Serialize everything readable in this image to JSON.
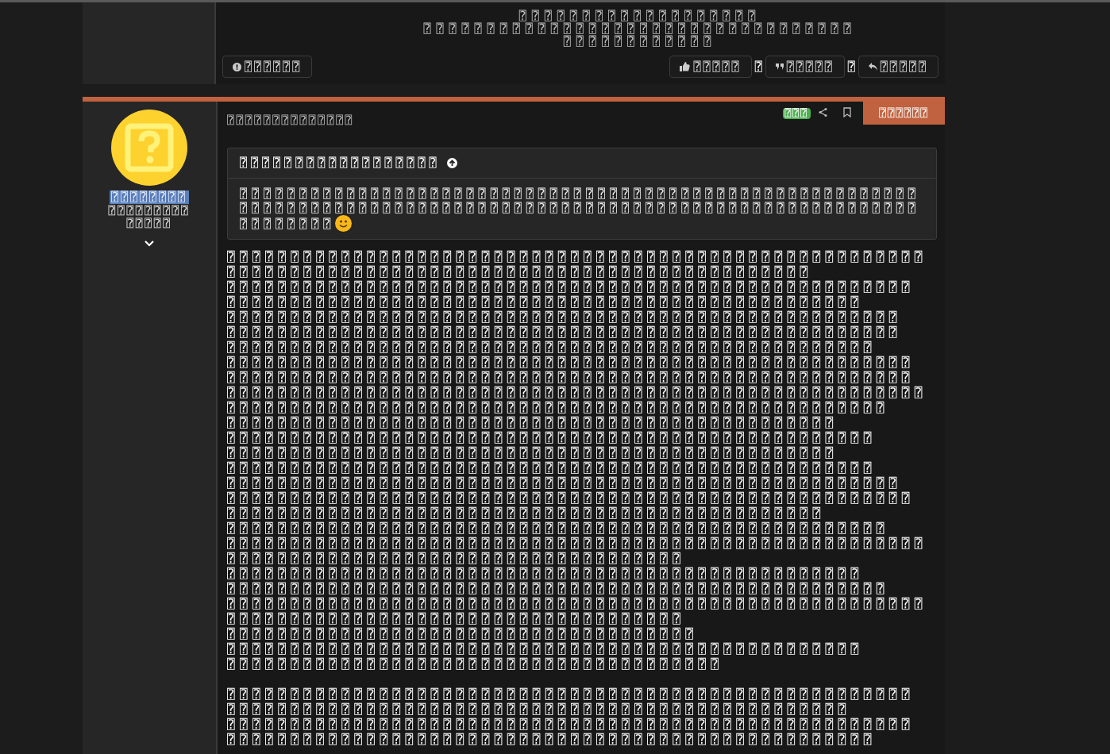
{
  "previous_post": {
    "signature_lines": [
      "⍰⍰⍰⍰⍰⍰⍰⍰⍰⍰⍰⍰⍰⍰⍰⍰⍰⍰⍰",
      "⍰⍰⍰⍰⍰⍰⍰⍰⍰⍰⍰⍰⍰⍰⍰⍰⍰⍰⍰⍰⍰⍰⍰⍰⍰⍰⍰⍰⍰⍰⍰⍰⍰⍰",
      "⍰⍰⍰⍰⍰⍰⍰⍰⍰⍰⍰⍰"
    ],
    "report_button": "⍰⍰⍰⍰⍰⍰",
    "like_button": "⍰⍰⍰⍰⍰",
    "like_count": "⍰",
    "quote_button": "⍰⍰⍰⍰⍰",
    "quote_count": "⍰",
    "reply_button": "⍰⍰⍰⍰⍰"
  },
  "post": {
    "author": {
      "name": "⍰⍰⍰⍰⍰⍰⍰⍰",
      "title": "⍰⍰⍰⍰⍰⍰⍰⍰⍰",
      "subtitle": "⍰⍰⍰⍰⍰"
    },
    "date": "⍰⍰⍰⍰⍰⍰⍰⍰⍰⍰⍰⍰⍰⍰",
    "badge": "⍰⍰⍰",
    "action_button": "⍰⍰⍰⍰⍰⍰",
    "quote": {
      "title": "⍰⍰⍰⍰⍰⍰⍰⍰⍰⍰⍰⍰⍰⍰⍰⍰⍰⍰",
      "lines": [
        "⍰⍰⍰⍰⍰⍰⍰⍰⍰⍰⍰⍰⍰⍰⍰⍰⍰⍰⍰⍰⍰⍰⍰⍰⍰⍰⍰⍰⍰⍰⍰⍰⍰⍰⍰⍰⍰⍰⍰⍰⍰⍰⍰⍰⍰⍰⍰⍰⍰⍰⍰⍰⍰⍰⍰⍰⍰",
        "⍰⍰⍰⍰⍰⍰⍰⍰⍰⍰⍰⍰⍰⍰⍰⍰⍰⍰⍰⍰⍰⍰⍰⍰⍰⍰⍰⍰⍰⍰⍰⍰⍰⍰⍰⍰⍰⍰⍰⍰⍰⍰⍰⍰⍰⍰⍰⍰⍰⍰⍰⍰⍰⍰⍰⍰⍰",
        "⍰⍰⍰⍰⍰⍰⍰⍰"
      ]
    },
    "paragraphs": [
      [
        "⍰⍰⍰⍰⍰⍰⍰⍰⍰⍰⍰⍰⍰⍰⍰⍰⍰⍰⍰⍰⍰⍰⍰⍰⍰⍰⍰⍰⍰⍰⍰⍰⍰⍰⍰⍰⍰⍰⍰⍰⍰⍰⍰⍰⍰⍰⍰⍰⍰⍰⍰⍰⍰⍰⍰",
        "⍰⍰⍰⍰⍰⍰⍰⍰⍰⍰⍰⍰⍰⍰⍰⍰⍰⍰⍰⍰⍰⍰⍰⍰⍰⍰⍰⍰⍰⍰⍰⍰⍰⍰⍰⍰⍰⍰⍰⍰⍰⍰⍰⍰⍰⍰",
        "⍰⍰⍰⍰⍰⍰⍰⍰⍰⍰⍰⍰⍰⍰⍰⍰⍰⍰⍰⍰⍰⍰⍰⍰⍰⍰⍰⍰⍰⍰⍰⍰⍰⍰⍰⍰⍰⍰⍰⍰⍰⍰⍰⍰⍰⍰⍰⍰⍰⍰⍰⍰⍰⍰",
        "⍰⍰⍰⍰⍰⍰⍰⍰⍰⍰⍰⍰⍰⍰⍰⍰⍰⍰⍰⍰⍰⍰⍰⍰⍰⍰⍰⍰⍰⍰⍰⍰⍰⍰⍰⍰⍰⍰⍰⍰⍰⍰⍰⍰⍰⍰⍰⍰⍰⍰",
        "⍰⍰⍰⍰⍰⍰⍰⍰⍰⍰⍰⍰⍰⍰⍰⍰⍰⍰⍰⍰⍰⍰⍰⍰⍰⍰⍰⍰⍰⍰⍰⍰⍰⍰⍰⍰⍰⍰⍰⍰⍰⍰⍰⍰⍰⍰⍰⍰⍰⍰⍰⍰⍰",
        "⍰⍰⍰⍰⍰⍰⍰⍰⍰⍰⍰⍰⍰⍰⍰⍰⍰⍰⍰⍰⍰⍰⍰⍰⍰⍰⍰⍰⍰⍰⍰⍰⍰⍰⍰⍰⍰⍰⍰⍰⍰⍰⍰⍰⍰⍰⍰⍰⍰⍰⍰⍰⍰",
        "⍰⍰⍰⍰⍰⍰⍰⍰⍰⍰⍰⍰⍰⍰⍰⍰⍰⍰⍰⍰⍰⍰⍰⍰⍰⍰⍰⍰⍰⍰⍰⍰⍰⍰⍰⍰⍰⍰⍰⍰⍰⍰⍰⍰⍰⍰⍰⍰⍰⍰⍰",
        "⍰⍰⍰⍰⍰⍰⍰⍰⍰⍰⍰⍰⍰⍰⍰⍰⍰⍰⍰⍰⍰⍰⍰⍰⍰⍰⍰⍰⍰⍰⍰⍰⍰⍰⍰⍰⍰⍰⍰⍰⍰⍰⍰⍰⍰⍰⍰⍰⍰⍰⍰⍰⍰⍰",
        "⍰⍰⍰⍰⍰⍰⍰⍰⍰⍰⍰⍰⍰⍰⍰⍰⍰⍰⍰⍰⍰⍰⍰⍰⍰⍰⍰⍰⍰⍰⍰⍰⍰⍰⍰⍰⍰⍰⍰⍰⍰⍰⍰⍰⍰⍰⍰⍰⍰⍰⍰⍰⍰⍰",
        "⍰⍰⍰⍰⍰⍰⍰⍰⍰⍰⍰⍰⍰⍰⍰⍰⍰⍰⍰⍰⍰⍰⍰⍰⍰⍰⍰⍰⍰⍰⍰⍰⍰⍰⍰⍰⍰⍰⍰⍰⍰⍰⍰⍰⍰⍰⍰⍰⍰⍰⍰⍰⍰⍰⍰",
        "⍰⍰⍰⍰⍰⍰⍰⍰⍰⍰⍰⍰⍰⍰⍰⍰⍰⍰⍰⍰⍰⍰⍰⍰⍰⍰⍰⍰⍰⍰⍰⍰⍰⍰⍰⍰⍰⍰⍰⍰⍰⍰⍰⍰⍰⍰⍰⍰⍰⍰⍰⍰",
        "⍰⍰⍰⍰⍰⍰⍰⍰⍰⍰⍰⍰⍰⍰⍰⍰⍰⍰⍰⍰⍰⍰⍰⍰⍰⍰⍰⍰⍰⍰⍰⍰⍰⍰⍰⍰⍰⍰⍰⍰⍰⍰⍰⍰⍰⍰⍰⍰",
        "⍰⍰⍰⍰⍰⍰⍰⍰⍰⍰⍰⍰⍰⍰⍰⍰⍰⍰⍰⍰⍰⍰⍰⍰⍰⍰⍰⍰⍰⍰⍰⍰⍰⍰⍰⍰⍰⍰⍰⍰⍰⍰⍰⍰⍰⍰⍰⍰⍰⍰⍰",
        "⍰⍰⍰⍰⍰⍰⍰⍰⍰⍰⍰⍰⍰⍰⍰⍰⍰⍰⍰⍰⍰⍰⍰⍰⍰⍰⍰⍰⍰⍰⍰⍰⍰⍰⍰⍰⍰⍰⍰⍰⍰⍰⍰⍰⍰⍰⍰⍰",
        "⍰⍰⍰⍰⍰⍰⍰⍰⍰⍰⍰⍰⍰⍰⍰⍰⍰⍰⍰⍰⍰⍰⍰⍰⍰⍰⍰⍰⍰⍰⍰⍰⍰⍰⍰⍰⍰⍰⍰⍰⍰⍰⍰⍰⍰⍰⍰⍰⍰⍰⍰",
        "⍰⍰⍰⍰⍰⍰⍰⍰⍰⍰⍰⍰⍰⍰⍰⍰⍰⍰⍰⍰⍰⍰⍰⍰⍰⍰⍰⍰⍰⍰⍰⍰⍰⍰⍰⍰⍰⍰⍰⍰⍰⍰⍰⍰⍰⍰⍰⍰⍰⍰⍰⍰⍰",
        "⍰⍰⍰⍰⍰⍰⍰⍰⍰⍰⍰⍰⍰⍰⍰⍰⍰⍰⍰⍰⍰⍰⍰⍰⍰⍰⍰⍰⍰⍰⍰⍰⍰⍰⍰⍰⍰⍰⍰⍰⍰⍰⍰⍰⍰⍰⍰⍰⍰⍰⍰⍰⍰⍰",
        "⍰⍰⍰⍰⍰⍰⍰⍰⍰⍰⍰⍰⍰⍰⍰⍰⍰⍰⍰⍰⍰⍰⍰⍰⍰⍰⍰⍰⍰⍰⍰⍰⍰⍰⍰⍰⍰⍰⍰⍰⍰⍰⍰⍰⍰⍰⍰",
        "⍰⍰⍰⍰⍰⍰⍰⍰⍰⍰⍰⍰⍰⍰⍰⍰⍰⍰⍰⍰⍰⍰⍰⍰⍰⍰⍰⍰⍰⍰⍰⍰⍰⍰⍰⍰⍰⍰⍰⍰⍰⍰⍰⍰⍰⍰⍰⍰⍰⍰⍰⍰",
        "⍰⍰⍰⍰⍰⍰⍰⍰⍰⍰⍰⍰⍰⍰⍰⍰⍰⍰⍰⍰⍰⍰⍰⍰⍰⍰⍰⍰⍰⍰⍰⍰⍰⍰⍰⍰⍰⍰⍰⍰⍰⍰⍰⍰⍰⍰⍰⍰⍰⍰⍰⍰⍰⍰⍰",
        "⍰⍰⍰⍰⍰⍰⍰⍰⍰⍰⍰⍰⍰⍰⍰⍰⍰⍰⍰⍰⍰⍰⍰⍰⍰⍰⍰⍰⍰⍰⍰⍰⍰⍰⍰⍰",
        "⍰⍰⍰⍰⍰⍰⍰⍰⍰⍰⍰⍰⍰⍰⍰⍰⍰⍰⍰⍰⍰⍰⍰⍰⍰⍰⍰⍰⍰⍰⍰⍰⍰⍰⍰⍰⍰⍰⍰⍰⍰⍰⍰⍰⍰⍰⍰⍰⍰⍰",
        "⍰⍰⍰⍰⍰⍰⍰⍰⍰⍰⍰⍰⍰⍰⍰⍰⍰⍰⍰⍰⍰⍰⍰⍰⍰⍰⍰⍰⍰⍰⍰⍰⍰⍰⍰⍰⍰⍰⍰⍰⍰⍰⍰⍰⍰⍰⍰⍰⍰⍰⍰⍰",
        "⍰⍰⍰⍰⍰⍰⍰⍰⍰⍰⍰⍰⍰⍰⍰⍰⍰⍰⍰⍰⍰⍰⍰⍰⍰⍰⍰⍰⍰⍰⍰⍰⍰⍰⍰⍰⍰⍰⍰⍰⍰⍰⍰⍰⍰⍰⍰⍰⍰⍰⍰⍰⍰⍰⍰",
        "⍰⍰⍰⍰⍰⍰⍰⍰⍰⍰⍰⍰⍰⍰⍰⍰⍰⍰⍰⍰⍰⍰⍰⍰⍰⍰⍰⍰⍰⍰⍰⍰⍰⍰⍰⍰",
        "⍰⍰⍰⍰⍰⍰⍰⍰⍰⍰⍰⍰⍰⍰⍰⍰⍰⍰⍰⍰⍰⍰⍰⍰⍰⍰⍰⍰⍰⍰⍰⍰⍰⍰⍰⍰⍰",
        "⍰⍰⍰⍰⍰⍰⍰⍰⍰⍰⍰⍰⍰⍰⍰⍰⍰⍰⍰⍰⍰⍰⍰⍰⍰⍰⍰⍰⍰⍰⍰⍰⍰⍰⍰⍰⍰⍰⍰⍰⍰⍰⍰⍰⍰⍰⍰⍰⍰⍰",
        "⍰⍰⍰⍰⍰⍰⍰⍰⍰⍰⍰⍰⍰⍰⍰⍰⍰⍰⍰⍰⍰⍰⍰⍰⍰⍰⍰⍰⍰⍰⍰⍰⍰⍰⍰⍰⍰⍰⍰"
      ],
      [
        "⍰⍰⍰⍰⍰⍰⍰⍰⍰⍰⍰⍰⍰⍰⍰⍰⍰⍰⍰⍰⍰⍰⍰⍰⍰⍰⍰⍰⍰⍰⍰⍰⍰⍰⍰⍰⍰⍰⍰⍰⍰⍰⍰⍰⍰⍰⍰⍰⍰⍰⍰⍰⍰⍰",
        "⍰⍰⍰⍰⍰⍰⍰⍰⍰⍰⍰⍰⍰⍰⍰⍰⍰⍰⍰⍰⍰⍰⍰⍰⍰⍰⍰⍰⍰⍰⍰⍰⍰⍰⍰⍰⍰⍰⍰⍰⍰⍰⍰⍰⍰⍰⍰⍰⍰",
        "⍰⍰⍰⍰⍰⍰⍰⍰⍰⍰⍰⍰⍰⍰⍰⍰⍰⍰⍰⍰⍰⍰⍰⍰⍰⍰⍰⍰⍰⍰⍰⍰⍰⍰⍰⍰⍰⍰⍰⍰⍰⍰⍰⍰⍰⍰⍰⍰⍰⍰⍰⍰⍰⍰",
        "⍰⍰⍰⍰⍰⍰⍰⍰⍰⍰⍰⍰⍰⍰⍰⍰⍰⍰⍰⍰⍰⍰⍰⍰⍰⍰⍰⍰⍰⍰⍰⍰⍰⍰⍰⍰⍰⍰⍰⍰⍰⍰⍰⍰⍰⍰⍰⍰⍰⍰⍰"
      ]
    ]
  }
}
